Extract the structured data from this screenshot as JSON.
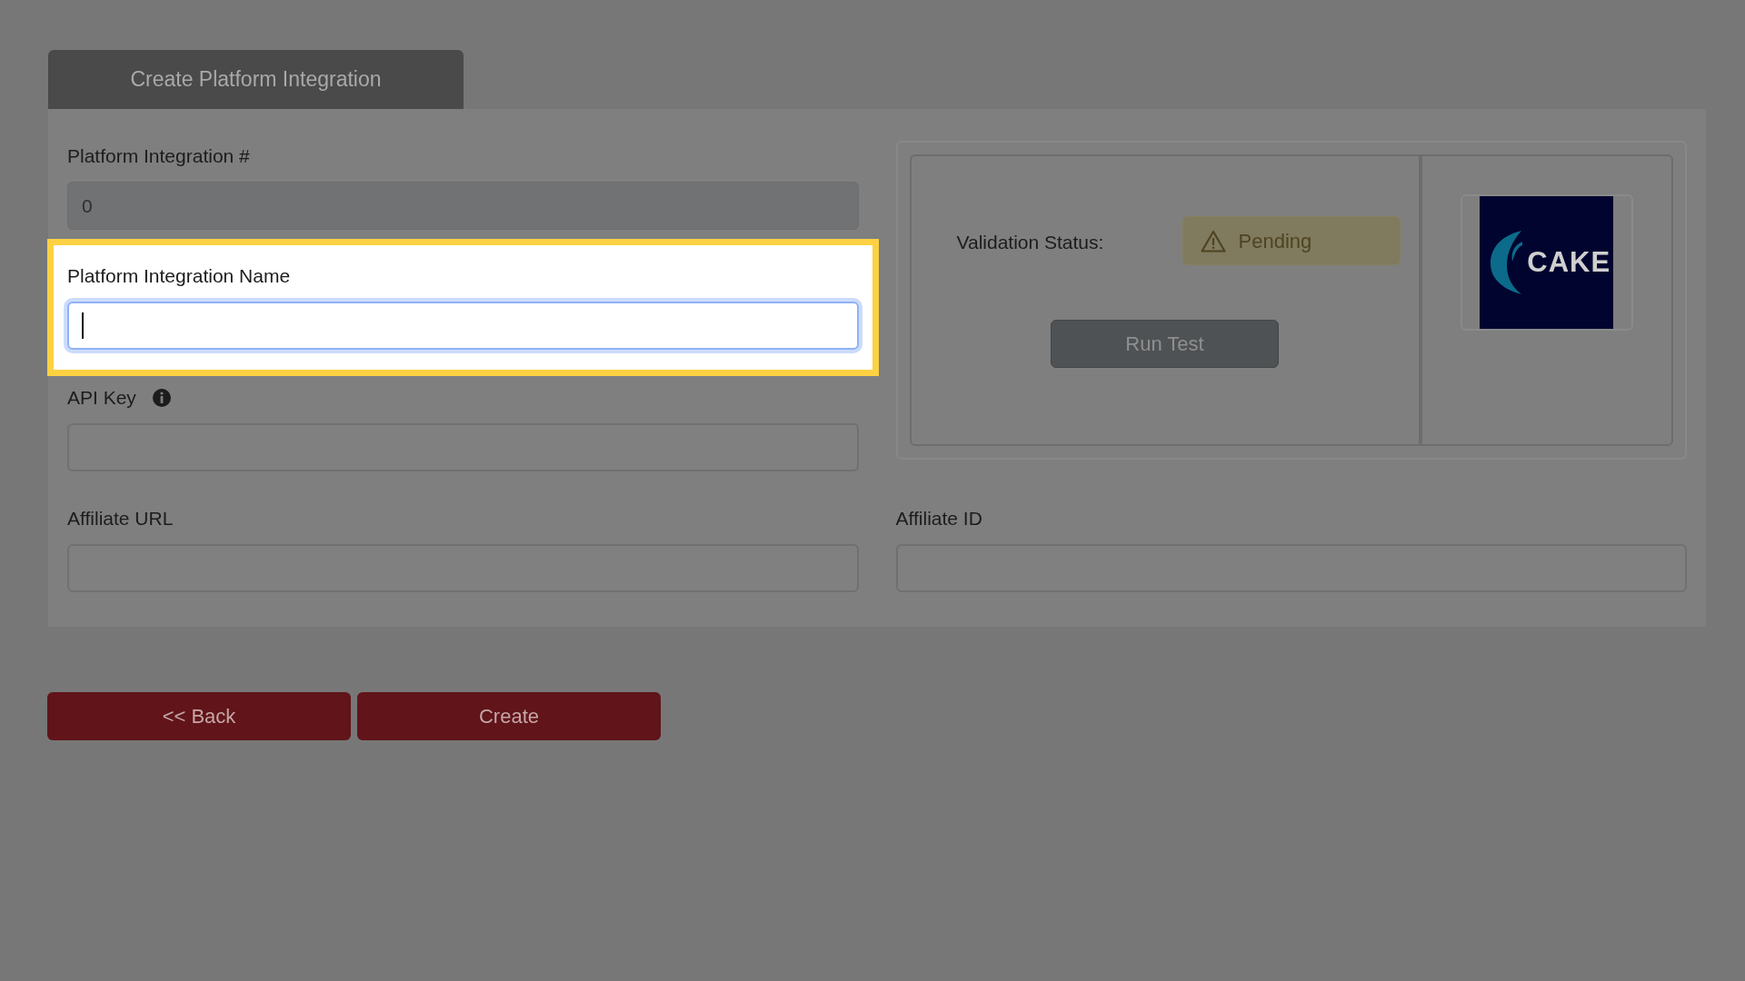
{
  "tab": {
    "label": "Create Platform Integration",
    "selected": true
  },
  "fields": [
    {
      "label": "Platform Integration #",
      "value": "0",
      "disabled": true
    },
    {
      "label": "Platform Integration Name",
      "highlighted": true,
      "focused": true
    },
    {
      "label": "API Key",
      "info": true
    },
    {
      "label": "Affiliate URL"
    },
    {
      "label": "Affiliate ID"
    }
  ],
  "validation": {
    "label": "Validation Status:",
    "status": "Pending",
    "button": "Run Test"
  },
  "logo": {
    "text": "CAKE"
  },
  "buttons": [
    "<< Back",
    "Create"
  ]
}
